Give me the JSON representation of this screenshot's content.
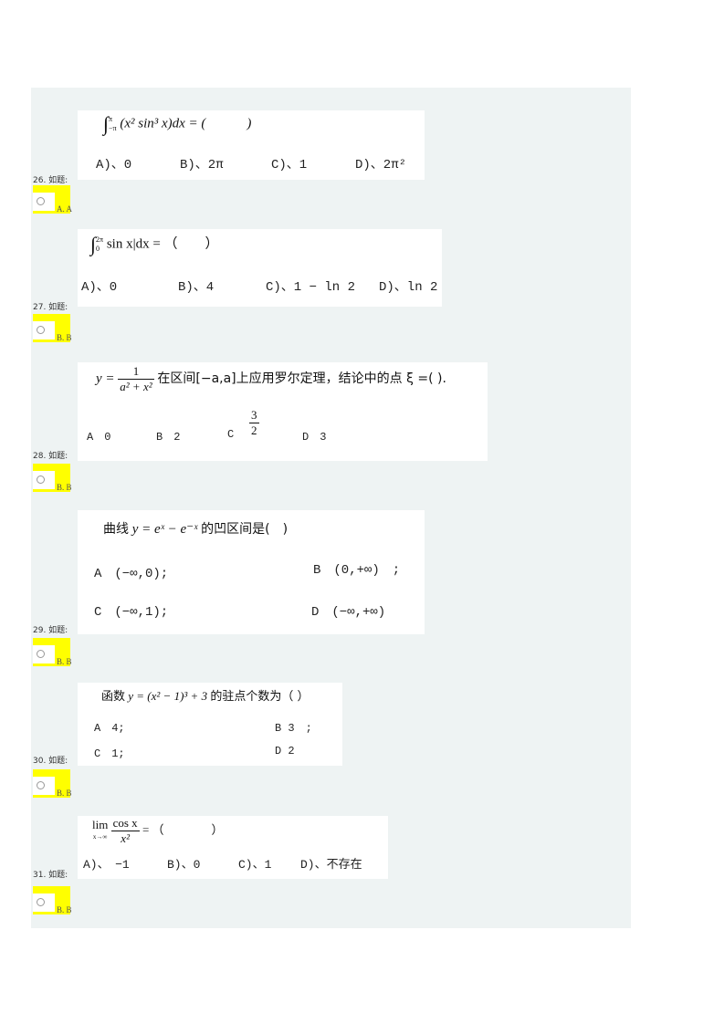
{
  "questions": [
    {
      "number": "26. 如题:",
      "stem": {
        "lower": "−π",
        "upper": "π",
        "integrand": "(x² sin³ x)dx = (　　　)"
      },
      "options": [
        "A)、0",
        "B)、2π",
        "C)、1",
        "D)、2π²"
      ],
      "answer_label": "A. A"
    },
    {
      "number": "27. 如题:",
      "stem": {
        "lower": "0",
        "upper": "2π",
        "integrand": "sin x|dx = （　　）"
      },
      "options": [
        "A)、0",
        "B)、4",
        "C)、1 − ln 2",
        "D)、ln 2"
      ],
      "answer_label": "B. B"
    },
    {
      "number": "28. 如题:",
      "stem": {
        "prefix": "y =",
        "frac_num": "1",
        "frac_den": "a² + x²",
        "text": "在区间[−a,a]上应用罗尔定理，结论中的点 ξ =( )."
      },
      "options": [
        "A　0",
        "B　2",
        "C",
        "D　3"
      ],
      "option_c_frac": {
        "num": "3",
        "den": "2"
      },
      "answer_label": "B. B"
    },
    {
      "number": "29. 如题:",
      "stem": {
        "prefix": "曲线",
        "formula": "y = eˣ − e⁻ˣ",
        "suffix": "的凹区间是(　)"
      },
      "options": [
        "A　(−∞,0);",
        "B　(0,+∞)　;",
        "C　(−∞,1);",
        "D　(−∞,+∞)"
      ],
      "answer_label": "B. B"
    },
    {
      "number": "30. 如题:",
      "stem": {
        "prefix": "函数",
        "formula": "y = (x² − 1)³ + 3",
        "suffix": "的驻点个数为（ ）"
      },
      "options": [
        "A　4;",
        "B 3　;",
        "C　1;",
        "D 2"
      ],
      "answer_label": "B. B"
    },
    {
      "number": "31. 如题:",
      "stem": {
        "lim": "lim",
        "sub": "x→∞",
        "frac_num": "cos x",
        "frac_den": "x²",
        "tail": "= （　　　　）"
      },
      "options": [
        "A)、　−1",
        "B)、0",
        "C)、1",
        "D)、不存在"
      ],
      "answer_label": "B. B"
    }
  ],
  "colors": {
    "panel": "#eef3f3",
    "highlight": "#ffff00",
    "card": "#ffffff"
  }
}
